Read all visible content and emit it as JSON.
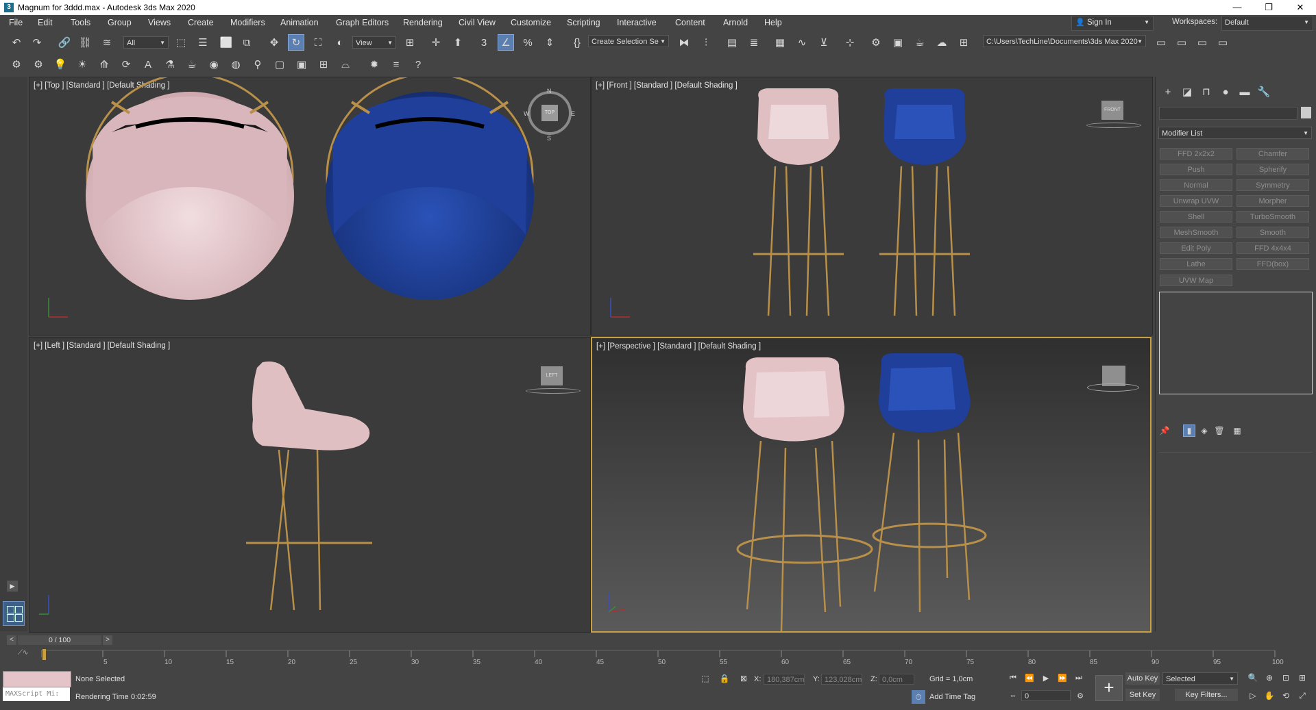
{
  "window": {
    "title": "Magnum for 3ddd.max - Autodesk 3ds Max 2020",
    "app_icon": "3",
    "controls": [
      "—",
      "❐",
      "✕"
    ]
  },
  "menu": [
    "File",
    "Edit",
    "Tools",
    "Group",
    "Views",
    "Create",
    "Modifiers",
    "Animation",
    "Graph Editors",
    "Rendering",
    "Civil View",
    "Customize",
    "Scripting",
    "Interactive",
    "Content",
    "Arnold",
    "Help"
  ],
  "account": {
    "sign_in": "Sign In",
    "workspaces_label": "Workspaces:",
    "workspace": "Default"
  },
  "main_toolbar": {
    "selection_filter": "All",
    "ref_coord": "View",
    "named_selection": "Create Selection Se",
    "project_path": "C:\\Users\\TechLine\\Documents\\3ds Max 2020"
  },
  "viewports": {
    "top": {
      "label": "[+] [Top ] [Standard ] [Default Shading ]",
      "compass": {
        "n": "N",
        "s": "S",
        "e": "E",
        "w": "W",
        "cube": "TOP"
      }
    },
    "front": {
      "label": "[+] [Front ] [Standard ] [Default Shading ]",
      "cube": "FRONT"
    },
    "left": {
      "label": "[+] [Left ] [Standard ] [Default Shading ]",
      "cube": "LEFT"
    },
    "persp": {
      "label": "[+] [Perspective ] [Standard ] [Default Shading ]"
    }
  },
  "command_panel": {
    "modifier_list": "Modifier List",
    "modifiers": [
      [
        "FFD 2x2x2",
        "Chamfer"
      ],
      [
        "Push",
        "Spherify"
      ],
      [
        "Normal",
        "Symmetry"
      ],
      [
        "Unwrap UVW",
        "Morpher"
      ],
      [
        "Shell",
        "TurboSmooth"
      ],
      [
        "MeshSmooth",
        "Smooth"
      ],
      [
        "Edit Poly",
        "FFD 4x4x4"
      ],
      [
        "Lathe",
        "FFD(box)"
      ],
      [
        "UVW Map",
        ""
      ]
    ]
  },
  "timeline": {
    "frame_display": "0 / 100",
    "ticks": [
      "5",
      "10",
      "15",
      "20",
      "25",
      "30",
      "35",
      "40",
      "45",
      "50",
      "55",
      "60",
      "65",
      "70",
      "75",
      "80",
      "85",
      "90",
      "95",
      "100"
    ]
  },
  "status": {
    "maxscript": "MAXScript Mi:",
    "selection": "None Selected",
    "rendering_time_label": "Rendering Time",
    "rendering_time": "0:02:59",
    "x_label": "X:",
    "x": "180,387cm",
    "y_label": "Y:",
    "y": "123,028cm",
    "z_label": "Z:",
    "z": "0,0cm",
    "grid": "Grid = 1,0cm",
    "add_time_tag": "Add Time Tag",
    "auto_key": "Auto Key",
    "set_key": "Set Key",
    "key_mode": "Selected",
    "key_filters": "Key Filters...",
    "frame": "0"
  },
  "colors": {
    "pink": "#e3c2c6",
    "blue": "#1f3f9a",
    "gold": "#b8904a",
    "accent": "#c8a040"
  }
}
